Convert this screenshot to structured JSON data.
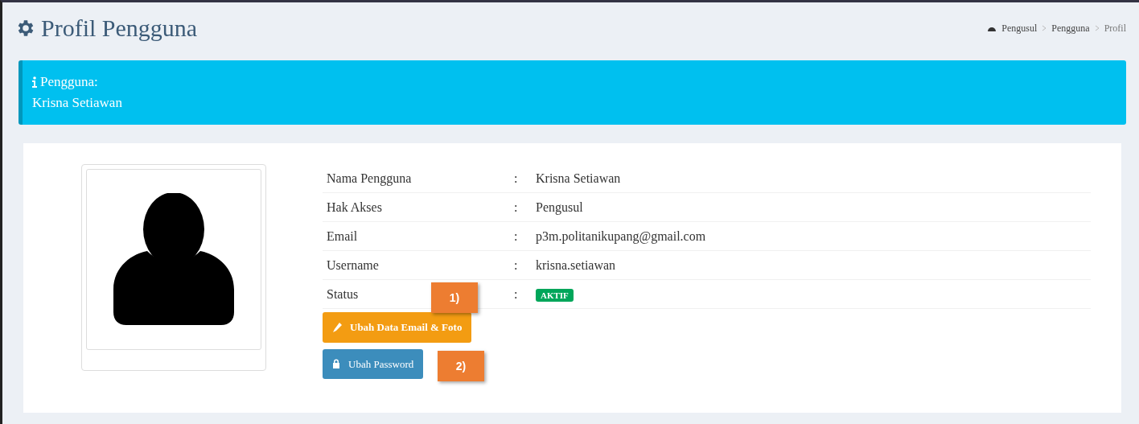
{
  "header": {
    "title": "Profil Pengguna"
  },
  "breadcrumb": [
    {
      "label": "Pengusul",
      "kind": "home"
    },
    {
      "label": "Pengguna",
      "kind": "link"
    },
    {
      "label": "Profil",
      "kind": "current"
    }
  ],
  "callout": {
    "label": "Pengguna:",
    "value": "Krisna Setiawan"
  },
  "profile": {
    "avatar": {
      "kind": "silhouette"
    },
    "fields": [
      {
        "label": "Nama Pengguna",
        "separator": ":",
        "value": "Krisna Setiawan",
        "kind": "text"
      },
      {
        "label": "Hak Akses",
        "separator": ":",
        "value": "Pengusul",
        "kind": "text"
      },
      {
        "label": "Email",
        "separator": ":",
        "value": "p3m.politanikupang@gmail.com",
        "kind": "text"
      },
      {
        "label": "Username",
        "separator": ":",
        "value": "krisna.setiawan",
        "kind": "text"
      },
      {
        "label": "Status",
        "separator": ":",
        "value": "AKTIF",
        "kind": "badge"
      }
    ],
    "buttons": [
      {
        "label": "Ubah Data Email & Foto",
        "kind": "warning"
      },
      {
        "label": "Ubah Password",
        "kind": "primary"
      }
    ]
  },
  "annotations": [
    {
      "label": "1)"
    },
    {
      "label": "2)"
    }
  ]
}
